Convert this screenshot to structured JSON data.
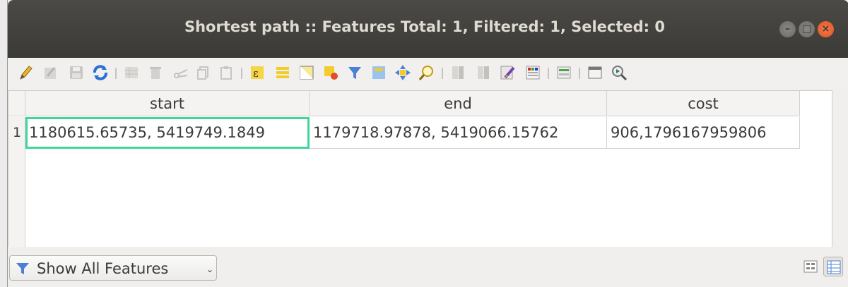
{
  "window": {
    "title": "Shortest path :: Features Total: 1, Filtered: 1, Selected: 0",
    "controls": [
      "minimize",
      "maximize",
      "close"
    ]
  },
  "toolbar": {
    "icons": [
      "toggle-editing-icon",
      "multi-edit-icon",
      "save-edits-icon",
      "reload-icon",
      "add-feature-icon",
      "delete-feature-icon",
      "cut-icon",
      "copy-icon",
      "paste-icon",
      "select-by-expression-icon",
      "select-all-icon",
      "invert-selection-icon",
      "deselect-all-icon",
      "filter-selection-icon",
      "move-selection-to-top-icon",
      "pan-to-selection-icon",
      "zoom-to-selection-icon",
      "new-field-icon",
      "delete-field-icon",
      "field-calculator-icon",
      "conditional-formatting-icon",
      "actions-icon",
      "dock-window-icon",
      "open-field-calculator-icon"
    ]
  },
  "table": {
    "columns": [
      "start",
      "end",
      "cost"
    ],
    "rows": [
      {
        "row_number": "1",
        "start": "1180615.65735, 5419749.1849",
        "end": "1179718.97878, 5419066.15762",
        "cost": "906,1796167959806"
      }
    ]
  },
  "bottom": {
    "filter_label": "Show All Features",
    "views": [
      "form-view",
      "table-view"
    ]
  },
  "colors": {
    "titlebar": "#3c3b37",
    "selection_border": "#41d699",
    "close_button": "#e95420"
  }
}
